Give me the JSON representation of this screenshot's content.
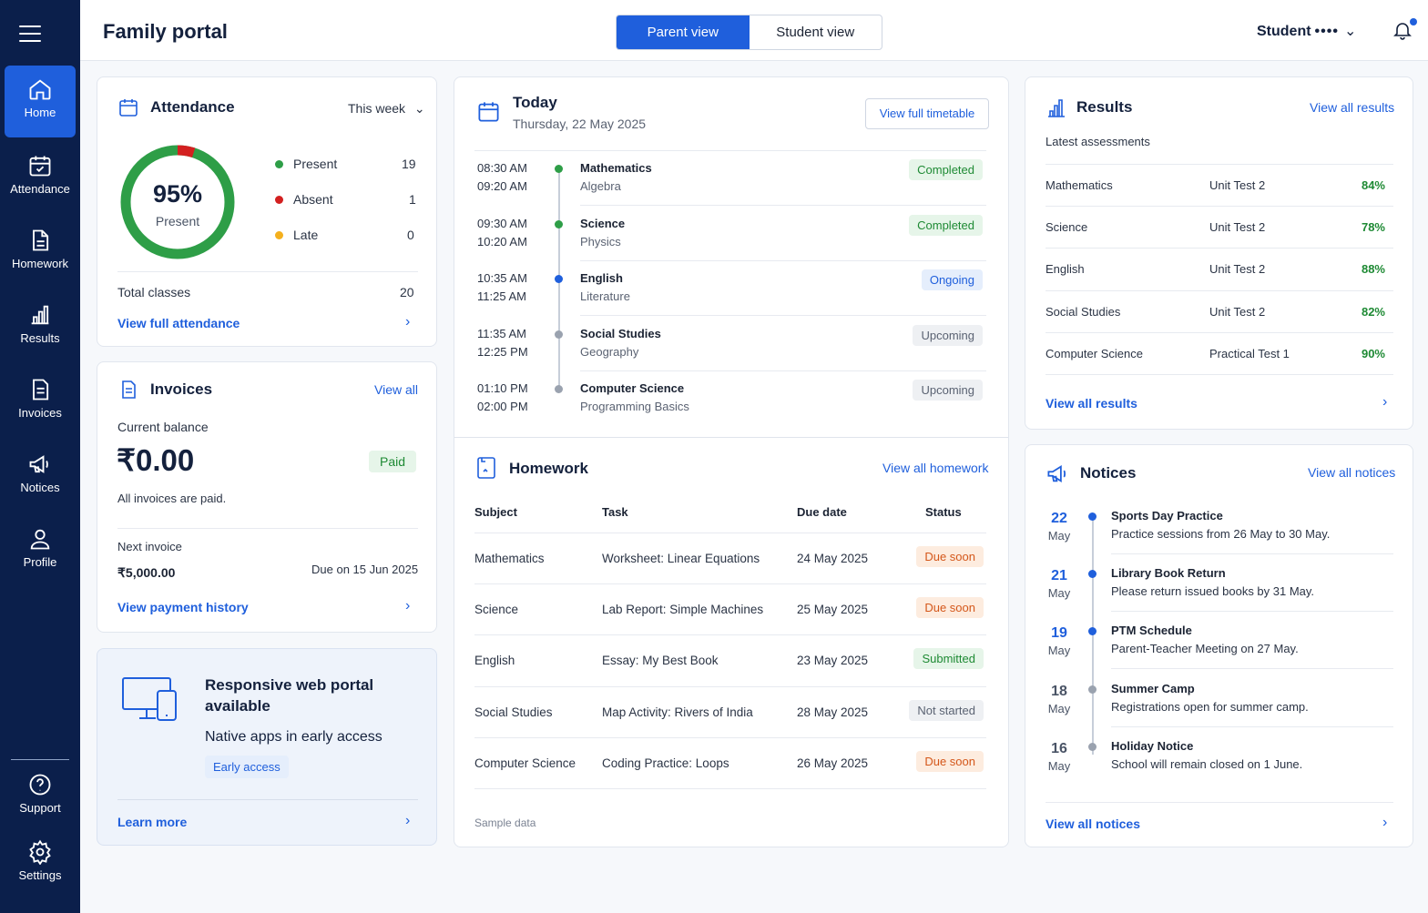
{
  "app": {
    "title": "Family portal"
  },
  "sidebar": {
    "items": [
      {
        "label": "Home",
        "icon": "home-icon"
      },
      {
        "label": "Attendance",
        "icon": "calendar-check-icon"
      },
      {
        "label": "Homework",
        "icon": "document-icon"
      },
      {
        "label": "Results",
        "icon": "bar-chart-icon"
      },
      {
        "label": "Invoices",
        "icon": "invoice-icon"
      },
      {
        "label": "Notices",
        "icon": "megaphone-icon"
      },
      {
        "label": "Profile",
        "icon": "user-icon"
      }
    ],
    "bottom": [
      {
        "label": "Support",
        "icon": "help-icon"
      },
      {
        "label": "Settings",
        "icon": "gear-icon"
      }
    ]
  },
  "header": {
    "views": [
      "Parent view",
      "Student view"
    ],
    "user": "Student",
    "user_mask": "••••"
  },
  "attendance": {
    "title": "Attendance",
    "period": "This week",
    "percent": "95%",
    "percent_label": "Present",
    "present_fraction": 0.95,
    "rows": [
      {
        "label": "Present",
        "value": "19",
        "color": "#2e9e47"
      },
      {
        "label": "Absent",
        "value": "1",
        "color": "#d32020"
      },
      {
        "label": "Late",
        "value": "0",
        "color": "#f4b01e"
      }
    ],
    "total_label": "Total classes",
    "total_value": "20",
    "link": "View full attendance"
  },
  "invoices": {
    "title": "Invoices",
    "view_all": "View all",
    "balance_label": "Current balance",
    "balance": "₹0.00",
    "status": "Paid",
    "note": "All invoices are paid.",
    "next_label": "Next invoice",
    "next_amount": "₹5,000.00",
    "next_due": "Due on 15 Jun 2025",
    "link": "View payment history"
  },
  "promo": {
    "title": "Responsive web portal available",
    "subtitle": "Native apps in early access",
    "chip": "Early access",
    "link": "Learn more"
  },
  "today": {
    "title": "Today",
    "date": "Thursday, 22 May 2025",
    "button": "View full timetable",
    "sessions": [
      {
        "start": "08:30 AM",
        "end": "09:20 AM",
        "subject": "Mathematics",
        "topic": "Algebra",
        "status": "Completed",
        "kind": "green"
      },
      {
        "start": "09:30 AM",
        "end": "10:20 AM",
        "subject": "Science",
        "topic": "Physics",
        "status": "Completed",
        "kind": "green"
      },
      {
        "start": "10:35 AM",
        "end": "11:25 AM",
        "subject": "English",
        "topic": "Literature",
        "status": "Ongoing",
        "kind": "blue"
      },
      {
        "start": "11:35 AM",
        "end": "12:25 PM",
        "subject": "Social Studies",
        "topic": "Geography",
        "status": "Upcoming",
        "kind": "gray"
      },
      {
        "start": "01:10 PM",
        "end": "02:00 PM",
        "subject": "Computer Science",
        "topic": "Programming Basics",
        "status": "Upcoming",
        "kind": "gray"
      }
    ]
  },
  "homework": {
    "title": "Homework",
    "view_all": "View all homework",
    "columns": [
      "Subject",
      "Task",
      "Due date",
      "Status"
    ],
    "rows": [
      {
        "subject": "Mathematics",
        "task": "Worksheet: Linear Equations",
        "due": "24 May 2025",
        "status": "Due soon",
        "kind": "orange"
      },
      {
        "subject": "Science",
        "task": "Lab Report: Simple Machines",
        "due": "25 May 2025",
        "status": "Due soon",
        "kind": "orange"
      },
      {
        "subject": "English",
        "task": "Essay: My Best Book",
        "due": "23 May 2025",
        "status": "Submitted",
        "kind": "green"
      },
      {
        "subject": "Social Studies",
        "task": "Map Activity: Rivers of India",
        "due": "28 May 2025",
        "status": "Not started",
        "kind": "gray"
      },
      {
        "subject": "Computer Science",
        "task": "Coding Practice: Loops",
        "due": "26 May 2025",
        "status": "Due soon",
        "kind": "orange"
      }
    ],
    "footnote": "Sample data"
  },
  "results": {
    "title": "Results",
    "view_all": "View all results",
    "subtitle": "Latest assessments",
    "rows": [
      {
        "subject": "Mathematics",
        "test": "Unit Test 2",
        "score": "84%"
      },
      {
        "subject": "Science",
        "test": "Unit Test 2",
        "score": "78%"
      },
      {
        "subject": "English",
        "test": "Unit Test 2",
        "score": "88%"
      },
      {
        "subject": "Social Studies",
        "test": "Unit Test 2",
        "score": "82%"
      },
      {
        "subject": "Computer Science",
        "test": "Practical Test 1",
        "score": "90%"
      }
    ],
    "link": "View all results"
  },
  "notices": {
    "title": "Notices",
    "view_all": "View all notices",
    "items": [
      {
        "day": "22",
        "month": "May",
        "title": "Sports Day Practice",
        "text": "Practice sessions from 26 May to 30 May.",
        "active": true
      },
      {
        "day": "21",
        "month": "May",
        "title": "Library Book Return",
        "text": "Please return issued books by 31 May.",
        "active": true
      },
      {
        "day": "19",
        "month": "May",
        "title": "PTM Schedule",
        "text": "Parent-Teacher Meeting on 27 May.",
        "active": true
      },
      {
        "day": "18",
        "month": "May",
        "title": "Summer Camp",
        "text": "Registrations open for summer camp.",
        "active": false
      },
      {
        "day": "16",
        "month": "May",
        "title": "Holiday Notice",
        "text": "School will remain closed on 1 June.",
        "active": false
      }
    ],
    "link": "View all notices"
  },
  "colors": {
    "primary": "#1f5fdc",
    "sidebar": "#0b1f4b",
    "success": "#1e8a34",
    "warning": "#d4571a"
  }
}
